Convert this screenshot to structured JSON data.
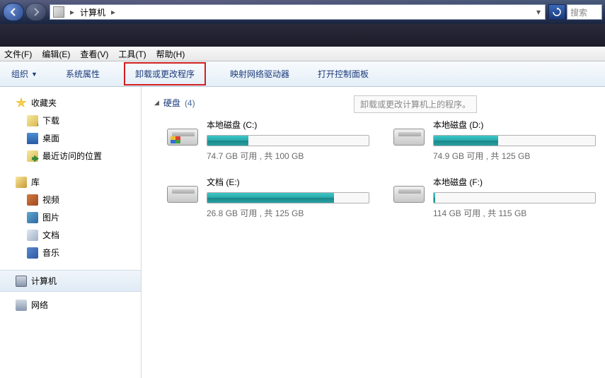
{
  "titlebar": {
    "location": "计算机",
    "search_placeholder": "搜索"
  },
  "menubar": {
    "file": "文件(F)",
    "edit": "编辑(E)",
    "view": "查看(V)",
    "tools": "工具(T)",
    "help": "帮助(H)"
  },
  "toolbar": {
    "organize": "组织",
    "sys_props": "系统属性",
    "uninstall": "卸载或更改程序",
    "map_drive": "映射网络驱动器",
    "control_panel": "打开控制面板"
  },
  "tooltip": "卸载或更改计算机上的程序。",
  "sidebar": {
    "favorites": {
      "label": "收藏夹",
      "items": [
        "下载",
        "桌面",
        "最近访问的位置"
      ]
    },
    "libraries": {
      "label": "库",
      "items": [
        "视频",
        "图片",
        "文档",
        "音乐"
      ]
    },
    "computer": "计算机",
    "network": "网络"
  },
  "group": {
    "label": "硬盘",
    "count": "(4)"
  },
  "drives": [
    {
      "name": "本地磁盘 (C:)",
      "free": 74.7,
      "total": 100,
      "stat": "74.7 GB 可用 , 共 100 GB",
      "win": true
    },
    {
      "name": "本地磁盘 (D:)",
      "free": 74.9,
      "total": 125,
      "stat": "74.9 GB 可用 , 共 125 GB",
      "win": false
    },
    {
      "name": "文档 (E:)",
      "free": 26.8,
      "total": 125,
      "stat": "26.8 GB 可用 , 共 125 GB",
      "win": false
    },
    {
      "name": "本地磁盘 (F:)",
      "free": 114,
      "total": 115,
      "stat": "114 GB 可用 , 共 115 GB",
      "win": false
    }
  ]
}
